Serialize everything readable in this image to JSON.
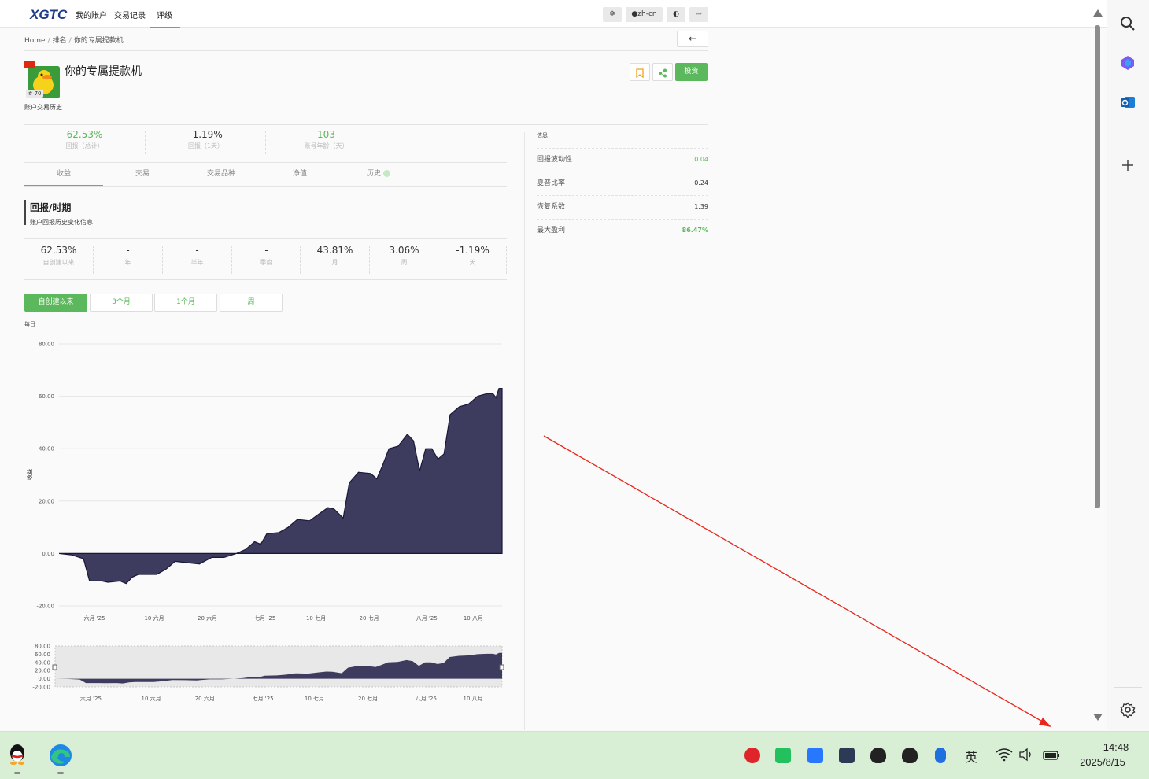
{
  "nav": {
    "logo": "XGTC",
    "items": [
      "我的账户",
      "交易记录",
      "评级"
    ],
    "active_index": 2,
    "toolbar": {
      "theme_icon": "gear-icon",
      "lang": "zh-cn",
      "contrast_icon": "half-circle-icon",
      "logout_icon": "logout-icon"
    }
  },
  "breadcrumb": [
    "Home",
    "排名",
    "你的专属提款机"
  ],
  "back_label": "←",
  "profile": {
    "name": "你的专属提款机",
    "rank": "# 70",
    "subtitle": "账户交易历史",
    "invest_label": "投资",
    "flag_color": "#de2910"
  },
  "stats": [
    {
      "value": "62.53%",
      "label": "回报（总计）",
      "green": true
    },
    {
      "value": "-1.19%",
      "label": "回报（1天）",
      "green": false
    },
    {
      "value": "103",
      "label": "账号年龄（天）",
      "green": true
    }
  ],
  "tabs": [
    "收益",
    "交易",
    "交易品种",
    "净值",
    "历史"
  ],
  "active_tab": 0,
  "section": {
    "title": "回报/时期",
    "desc": "账户回报历史变化信息"
  },
  "periods": [
    {
      "value": "62.53%",
      "label": "自创建以来"
    },
    {
      "value": "-",
      "label": "年"
    },
    {
      "value": "-",
      "label": "半年"
    },
    {
      "value": "-",
      "label": "季度"
    },
    {
      "value": "43.81%",
      "label": "月"
    },
    {
      "value": "3.06%",
      "label": "周"
    },
    {
      "value": "-1.19%",
      "label": "天"
    }
  ],
  "range_buttons": [
    "自创建以来",
    "3个月",
    "1个月",
    "周"
  ],
  "chart_note": "每日",
  "info": {
    "title": "信息",
    "rows": [
      {
        "label": "回报波动性",
        "value": "0.04",
        "green": true,
        "bold": false
      },
      {
        "label": "夏普比率",
        "value": "0.24",
        "green": false,
        "bold": false
      },
      {
        "label": "恢复系数",
        "value": "1.39",
        "green": false,
        "bold": false
      },
      {
        "label": "最大盈利",
        "value": "86.47%",
        "green": true,
        "bold": true
      }
    ]
  },
  "chart_data": {
    "type": "area",
    "ylabel": "收益",
    "ylim": [
      -20,
      80
    ],
    "yticks": [
      "80.00",
      "60.00",
      "40.00",
      "20.00",
      "0.00",
      "-20.00"
    ],
    "xticks": [
      "六月 '25",
      "10 六月",
      "20 六月",
      "七月 '25",
      "10 七月",
      "20 七月",
      "八月 '25",
      "10 八月"
    ],
    "nav_yticks": [
      "80.00",
      "60.00",
      "40.00",
      "20.00",
      "0.00",
      "-20.00"
    ],
    "color": "#3d3b5e",
    "points": [
      [
        0,
        0
      ],
      [
        4,
        -0.5
      ],
      [
        8,
        -2
      ],
      [
        10,
        -10.5
      ],
      [
        14,
        -10.5
      ],
      [
        16,
        -11
      ],
      [
        20,
        -10.5
      ],
      [
        22,
        -11.5
      ],
      [
        24,
        -9
      ],
      [
        26,
        -8
      ],
      [
        32,
        -8
      ],
      [
        35,
        -6
      ],
      [
        38,
        -3
      ],
      [
        42,
        -3.5
      ],
      [
        46,
        -4
      ],
      [
        50,
        -1.5
      ],
      [
        54,
        -1.5
      ],
      [
        58,
        0
      ],
      [
        61,
        1.5
      ],
      [
        64,
        4.5
      ],
      [
        66,
        3.5
      ],
      [
        68,
        7.5
      ],
      [
        72,
        8
      ],
      [
        75,
        10
      ],
      [
        78,
        13
      ],
      [
        82,
        12.5
      ],
      [
        85,
        15
      ],
      [
        88,
        17.5
      ],
      [
        90,
        17
      ],
      [
        93,
        13.5
      ],
      [
        95,
        27
      ],
      [
        98,
        31
      ],
      [
        102,
        30.5
      ],
      [
        104,
        28.5
      ],
      [
        106,
        34
      ],
      [
        108,
        40
      ],
      [
        111,
        41
      ],
      [
        114,
        45.5
      ],
      [
        116,
        43
      ],
      [
        118,
        31.5
      ],
      [
        120,
        40
      ],
      [
        122,
        40
      ],
      [
        124,
        36
      ],
      [
        126,
        38
      ],
      [
        128,
        53
      ],
      [
        131,
        56
      ],
      [
        134,
        57
      ],
      [
        137,
        60
      ],
      [
        140,
        61
      ],
      [
        142,
        61
      ],
      [
        143,
        59.5
      ],
      [
        144,
        63
      ],
      [
        145,
        63
      ]
    ],
    "x_total": 145
  },
  "taskbar": {
    "time": "14:48",
    "date": "2025/8/15",
    "ime": "英",
    "apps": [
      "qq-icon",
      "edge-icon"
    ],
    "tray": [
      "netease-music-icon",
      "wechat-icon",
      "feishu-icon",
      "cat-icon",
      "qq-icon",
      "qq-icon",
      "bluetooth-icon"
    ]
  },
  "sidebar": [
    "search-icon",
    "copilot-icon",
    "outlook-icon",
    "plus-icon",
    "settings-icon"
  ],
  "annotation_arrow_color": "#e8261c"
}
